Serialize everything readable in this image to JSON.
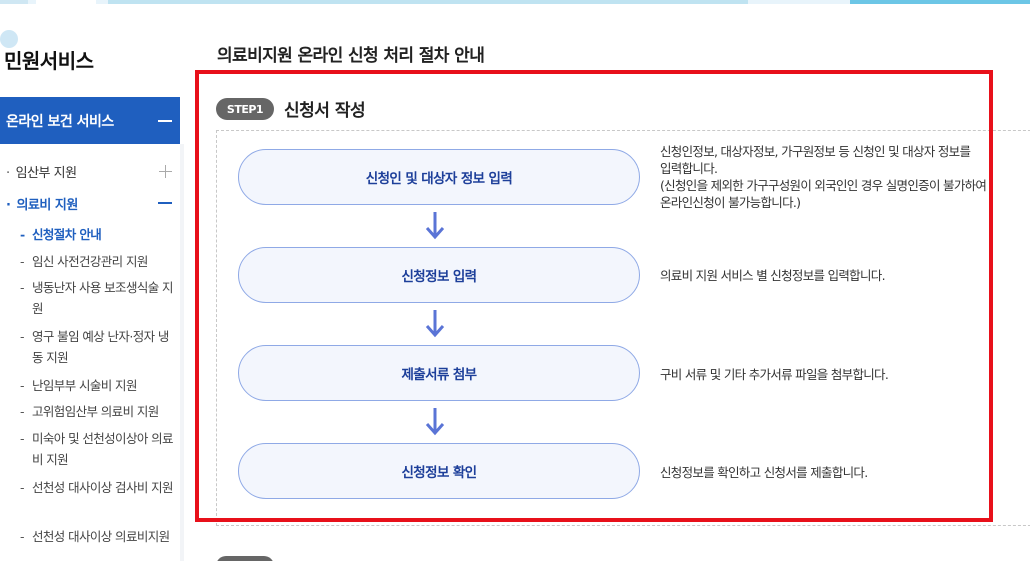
{
  "sidebar": {
    "title": "민원서비스",
    "section": {
      "label": "온라인 보건 서비스"
    },
    "l1_items": [
      {
        "label": "임산부 지원",
        "expanded": false
      },
      {
        "label": "의료비 지원",
        "expanded": true
      }
    ],
    "l2_items": [
      {
        "label": "신청절차 안내",
        "current": true
      },
      {
        "label": "임신 사전건강관리 지원"
      },
      {
        "label": "냉동난자 사용 보조생식술 지원"
      },
      {
        "label": "영구 불임 예상 난자·정자 냉동 지원"
      },
      {
        "label": "난임부부 시술비 지원"
      },
      {
        "label": "고위험임산부 의료비 지원"
      },
      {
        "label": "미숙아 및 선천성이상아 의료비 지원"
      },
      {
        "label": "선천성 대사이상 검사비 지원"
      },
      {
        "label": "선천성 대사이상 의료비지원"
      }
    ]
  },
  "main": {
    "page_title": "의료비지원 온라인 신청 처리 절차 안내",
    "step1": {
      "badge": "STEP1",
      "title": "신청서 작성",
      "steps": [
        {
          "label": "신청인 및 대상자 정보 입력",
          "desc_lines": [
            "신청인정보, 대상자정보, 가구원정보 등 신청인 및 대상자 정보를",
            "입력합니다.",
            "(신청인을 제외한 가구구성원이 외국인인 경우 실명인증이 불가하여",
            "온라인신청이 불가능합니다.)"
          ]
        },
        {
          "label": "신청정보 입력",
          "desc_lines": [
            "의료비 지원 서비스 별 신청정보를 입력합니다."
          ]
        },
        {
          "label": "제출서류 첨부",
          "desc_lines": [
            "구비 서류 및 기타 추가서류 파일을 첨부합니다."
          ]
        },
        {
          "label": "신청정보 확인",
          "desc_lines": [
            "신청정보를 확인하고 신청서를 제출합니다."
          ]
        }
      ]
    }
  },
  "colors": {
    "primary": "#1f5fbf",
    "highlight_border": "#e8101a",
    "pill_border": "#8fa9e6",
    "pill_bg": "#f3f6fd",
    "arrow": "#5a74d6",
    "badge_bg": "#666666"
  },
  "icons": {
    "section_toggle": "minus-icon",
    "expand": "plus-icon",
    "collapse": "minus-icon",
    "flow": "arrow-down-icon"
  }
}
